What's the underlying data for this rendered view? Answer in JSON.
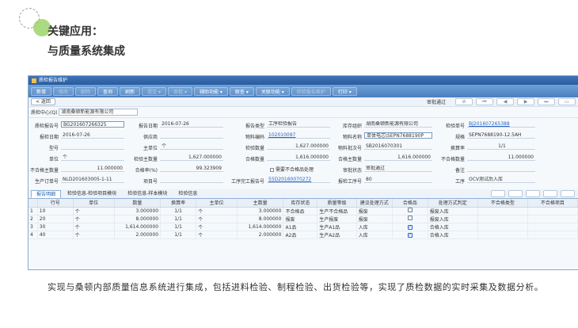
{
  "heading": {
    "title": "关键应用：",
    "subtitle": "与质量系统集成"
  },
  "window": {
    "title": "质检报告维护"
  },
  "toolbar": [
    "新增",
    "修改",
    "删除",
    "查询",
    "刷新",
    "提交",
    "审批",
    "辅助功能",
    "联查",
    "关联功能",
    "检验报告维护",
    "打印"
  ],
  "nav": {
    "back": "< 返回",
    "status": "审批通过",
    "pager": [
      "⏮",
      "◀",
      "▶",
      "⏭"
    ]
  },
  "org": {
    "label": "质检中心(Q)",
    "value": "湖南桑顿新能源有限公司"
  },
  "form": {
    "r1": {
      "l1": "质检报告号",
      "v1": "BG201607266325",
      "l2": "报告日期",
      "v2": "2016-07-26",
      "l3": "报告类型",
      "v3": "工序检验报告",
      "l4": "库存组织",
      "v4": "湖南桑顿新能源有限公司",
      "l5": "检验单号",
      "v5": "BJ201607265388"
    },
    "r2": {
      "l1": "报检日期",
      "v1": "2016-07-26",
      "l2": "供应商",
      "v2": "",
      "l3": "物料编码",
      "v3": "102010097",
      "l4": "物料名称",
      "v4": "单体电芯\\SEPN7688190P",
      "l5": "规格",
      "v5": "SEPN7688190-12.5AH"
    },
    "r3": {
      "l1": "型号",
      "v1": "",
      "l2": "主单位",
      "v2": "个",
      "l3": "检验数量",
      "v3": "1,627.000000",
      "l4": "物料批次号",
      "v4": "SB2016070301",
      "l5": "换算率",
      "v5": "1/1"
    },
    "r4": {
      "l1": "单位",
      "v1": "个",
      "l2": "检验主数量",
      "v2": "1,627.000000",
      "l3": "合格数量",
      "v3": "1,616.000000",
      "l4": "合格主数量",
      "v4": "1,616.000000",
      "l5": "不合格数量",
      "v5": "11.000000"
    },
    "r5": {
      "l1": "不合格主数量",
      "v1": "11.000000",
      "l2": "合格率(%)",
      "v2": "99.323909",
      "l3": "",
      "v3": "需要不合格品处理",
      "l4": "审批状态",
      "v4": "审批通过",
      "l5": "备注",
      "v5": ""
    },
    "r6": {
      "l1": "生产订单号",
      "v1": "NLD201603005-1-11",
      "l2": "项目号",
      "v2": "",
      "l3": "工序完工报告号",
      "v3": "55D20160070272",
      "l4": "报检工序号",
      "v4": "80",
      "l5": "工序",
      "v5": "OCV测试后入库"
    }
  },
  "tabs": [
    "报告明细",
    "检验信息-检验项目模块",
    "检验信息-样本模块",
    "检验信息"
  ],
  "table": {
    "headers": [
      "",
      "行号",
      "单位",
      "数量",
      "换算率",
      "主单位",
      "主数量",
      "库存状态",
      "质量等级",
      "建议处理方式",
      "合格品",
      "处理方式判定",
      "不合格类型",
      "不合格项目"
    ],
    "rows": [
      [
        "1",
        "10",
        "个",
        "3.000000",
        "1/1",
        "个",
        "3.000000",
        "不合格品",
        "生产不合格品",
        "报废",
        false,
        "报废入库",
        "",
        ""
      ],
      [
        "2",
        "20",
        "个",
        "8.000000",
        "1/1",
        "个",
        "8.000000",
        "报废",
        "生产报废",
        "报废",
        false,
        "报废入库",
        "",
        ""
      ],
      [
        "3",
        "30",
        "个",
        "1,614.000000",
        "1/1",
        "个",
        "1,614.000000",
        "A1品",
        "生产A1品",
        "入库",
        true,
        "合格入库",
        "",
        ""
      ],
      [
        "4",
        "40",
        "个",
        "2.000000",
        "1/1",
        "个",
        "2.000000",
        "A2品",
        "生产A2品",
        "入库",
        true,
        "合格入库",
        "",
        ""
      ]
    ]
  },
  "paragraph": "实现与桑顿内部质量信息系统进行集成，包括进料检验、制程检验、出货检验等，实现了质检数据的实时采集及数据分析。"
}
